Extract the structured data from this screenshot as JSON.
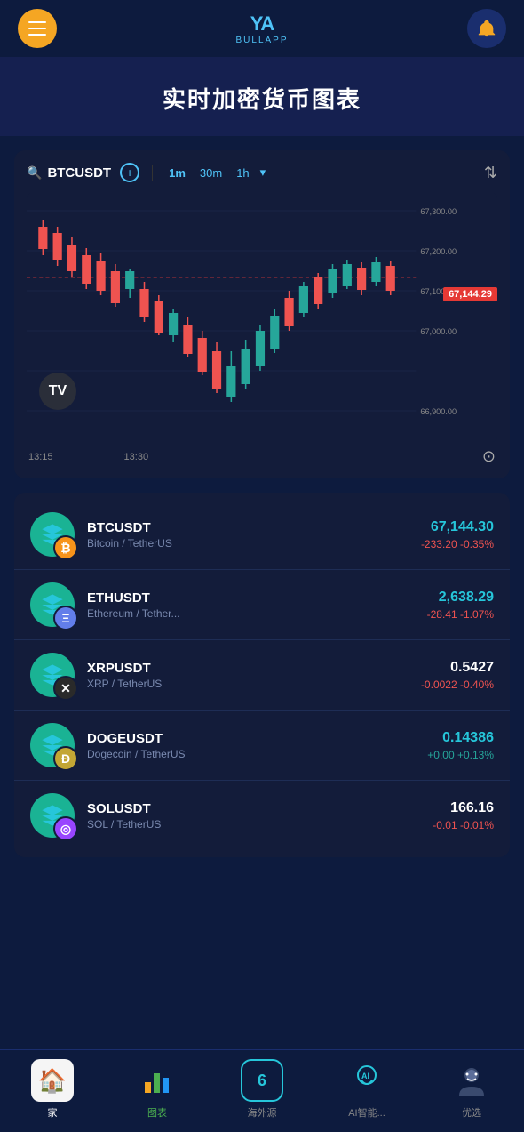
{
  "header": {
    "menu_label": "menu",
    "logo_icon": "YA",
    "logo_subtext": "BULLAPP",
    "bell_label": "notifications"
  },
  "page_title": "实时加密货币图表",
  "chart": {
    "symbol": "BTCUSDT",
    "timeframes": [
      "1m",
      "30m",
      "1h"
    ],
    "active_price": "67,144.29",
    "price_levels": [
      "67,300.00",
      "67,200.00",
      "67,144.29",
      "67,100.00",
      "67,000.00",
      "66,900.00"
    ],
    "time_labels": [
      "13:15",
      "13:30"
    ],
    "watermark": "TV",
    "settings_icon": "⚙"
  },
  "crypto_list": [
    {
      "symbol": "BTCUSDT",
      "name": "Bitcoin / TetherUS",
      "price": "67,144.30",
      "change": "-233.20  -0.35%",
      "price_color": "teal",
      "change_color": "red",
      "coin_type": "btc",
      "icon": "₿"
    },
    {
      "symbol": "ETHUSDT",
      "name": "Ethereum / Tether...",
      "price": "2,638.29",
      "change": "-28.41  -1.07%",
      "price_color": "teal",
      "change_color": "red",
      "coin_type": "eth",
      "icon": "Ξ"
    },
    {
      "symbol": "XRPUSDT",
      "name": "XRP / TetherUS",
      "price": "0.5427",
      "change": "-0.0022  -0.40%",
      "price_color": "white",
      "change_color": "red",
      "coin_type": "xrp",
      "icon": "✕"
    },
    {
      "symbol": "DOGEUSDT",
      "name": "Dogecoin / TetherUS",
      "price": "0.14386",
      "change": "+0.00  +0.13%",
      "price_color": "teal",
      "change_color": "green",
      "coin_type": "doge",
      "icon": "Ð"
    },
    {
      "symbol": "SOLUSDT",
      "name": "SOL / TetherUS",
      "price": "166.16",
      "change": "-0.01  -0.01%",
      "price_color": "white",
      "change_color": "red",
      "coin_type": "sol",
      "icon": "◎"
    }
  ],
  "bottom_nav": [
    {
      "label": "家",
      "icon": "🏠",
      "active": true,
      "id": "home"
    },
    {
      "label": "图表",
      "icon": "📊",
      "active": false,
      "id": "chart",
      "green": true
    },
    {
      "label": "海外源",
      "icon": "6",
      "active": false,
      "id": "six"
    },
    {
      "label": "AI智能...",
      "icon": "AI",
      "active": false,
      "id": "ai"
    },
    {
      "label": "优选",
      "icon": "👤",
      "active": false,
      "id": "user"
    }
  ]
}
